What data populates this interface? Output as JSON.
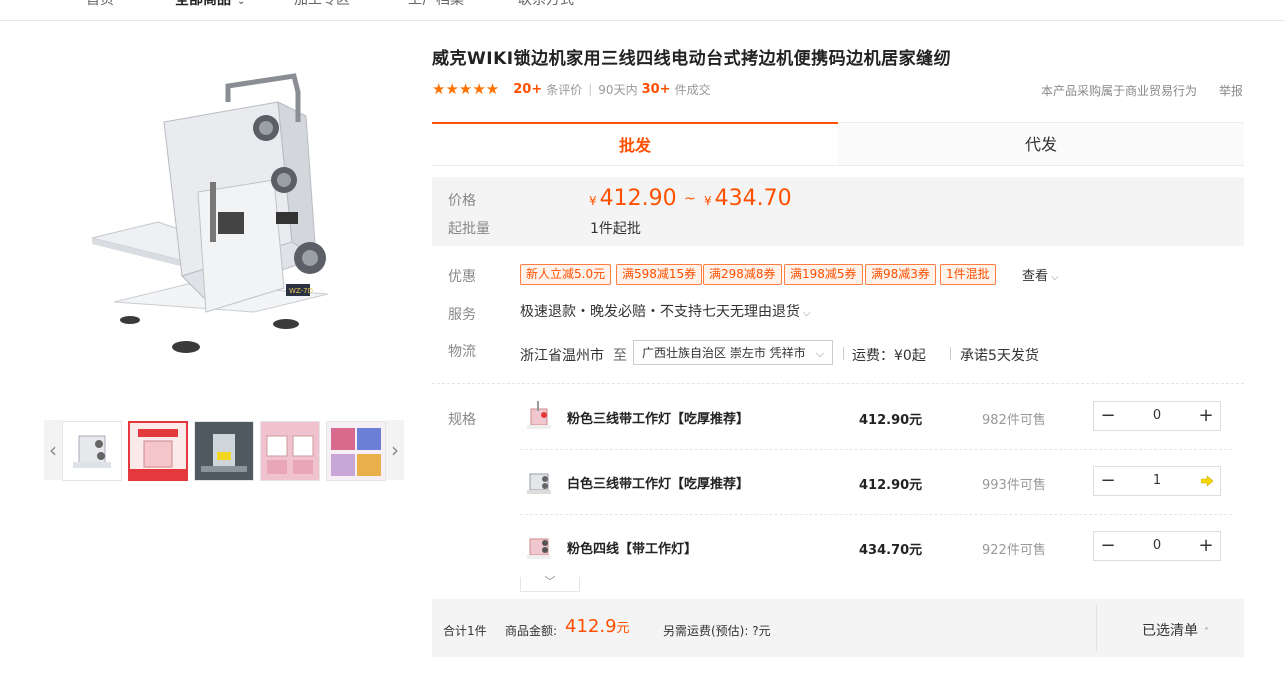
{
  "nav": {
    "items": [
      {
        "label": "首页",
        "active": false
      },
      {
        "label": "全部商品",
        "active": true
      },
      {
        "label": "加工专区",
        "active": false
      },
      {
        "label": "工厂档案",
        "active": false
      },
      {
        "label": "联系方式",
        "active": false
      }
    ]
  },
  "gallery": {
    "prev_icon": "chevron-left-icon",
    "next_icon": "chevron-right-icon"
  },
  "product": {
    "title": "威克WIKI锁边机家用三线四线电动台式拷边机便携码边机居家缝纫",
    "stars": "★★★★★",
    "review_count": "20+",
    "review_label": "条评价",
    "sales_period": "90天内",
    "sales_count": "30+",
    "sales_label": "件成交",
    "trade_note": "本产品采购属于商业贸易行为",
    "report_label": "举报"
  },
  "tabs": {
    "wholesale": "批发",
    "dropship": "代发"
  },
  "pricing": {
    "price_label": "价格",
    "currency": "¥",
    "price_min": "412.90",
    "range_sep": "~",
    "price_max": "434.70",
    "moq_label": "起批量",
    "moq_value": "1件起批"
  },
  "promotions": {
    "label": "优惠",
    "tags": [
      "新人立减5.0元",
      "满598减15券",
      "满298减8券",
      "满198减5券",
      "满98减3券",
      "1件混批"
    ],
    "view_label": "查看"
  },
  "service": {
    "label": "服务",
    "text": "极速退款・晚发必赔・不支持七天无理由退货"
  },
  "logistics": {
    "label": "物流",
    "origin": "浙江省温州市",
    "to_label": "至",
    "destination": "广西壮族自治区 崇左市 凭祥市",
    "shipping_fee": "运费：¥0起",
    "promise": "承诺5天发货"
  },
  "sku": {
    "label": "规格",
    "rows": [
      {
        "name": "粉色三线带工作灯【吃厚推荐】",
        "price": "412.90元",
        "stock": "982件可售",
        "qty": "0"
      },
      {
        "name": "白色三线带工作灯【吃厚推荐】",
        "price": "412.90元",
        "stock": "993件可售",
        "qty": "1"
      },
      {
        "name": "粉色四线【带工作灯】",
        "price": "434.70元",
        "stock": "922件可售",
        "qty": "0"
      }
    ],
    "minus": "−",
    "plus": "+"
  },
  "summary": {
    "total_items": "合计1件",
    "amount_label": "商品金额:",
    "amount": "412.9",
    "amount_unit": "元",
    "shipping_note": "另需运费(预估): ?元",
    "list_label": "已选清单"
  },
  "colors": {
    "accent": "#ff5000",
    "promo_border": "#ff7d40",
    "panel_bg": "#f4f4f4"
  }
}
